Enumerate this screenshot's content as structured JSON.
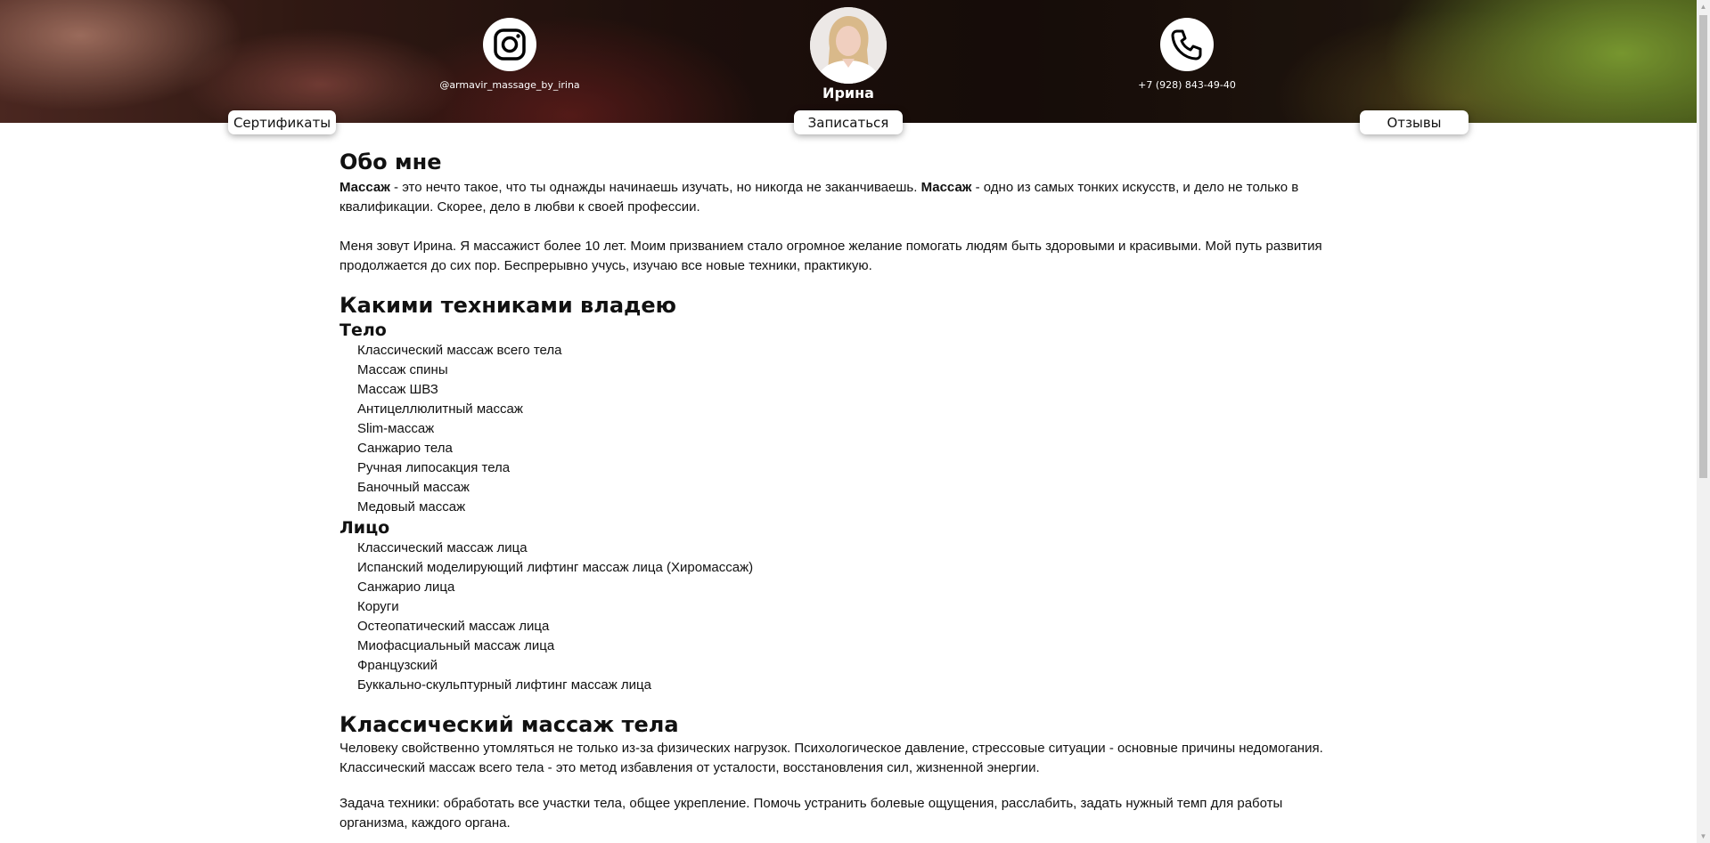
{
  "header": {
    "instagram_handle": "@armavir_massage_by_irina",
    "phone": "+7 (928) 843-49-40",
    "name": "Ирина",
    "buttons": {
      "certificates": "Сертификаты",
      "signup": "Записаться",
      "reviews": "Отзывы"
    }
  },
  "about": {
    "title": "Обо мне",
    "p1_bold1": "Массаж",
    "p1_mid": " - это нечто такое, что ты однажды начинаешь изучать, но никогда не заканчиваешь. ",
    "p1_bold2": "Массаж",
    "p1_end": " - одно из самых тонких искусств, и дело не только в квалификации. Скорее, дело в любви к своей профессии.",
    "p2": "Меня зовут Ирина. Я массажист более 10 лет. Моим призванием стало огромное желание помогать людям быть здоровыми и красивыми. Мой путь развития продолжается до сих пор. Беспрерывно учусь, изучаю все новые техники, практикую."
  },
  "techniques": {
    "title": "Какими техниками владею",
    "body_title": "Тело",
    "body": [
      "Классический массаж всего тела",
      "Массаж спины",
      "Массаж ШВЗ",
      "Антицеллюлитный массаж",
      "Slim-массаж",
      "Санжарио тела",
      "Ручная липосакция тела",
      "Баночный массаж",
      "Медовый массаж"
    ],
    "face_title": "Лицо",
    "face": [
      "Классический массаж лица",
      "Испанский моделирующий лифтинг массаж лица (Хиромассаж)",
      "Санжарио лица",
      "Коруги",
      "Остеопатический массаж лица",
      "Миофасциальный массаж лица",
      "Французский",
      "Буккально-скульптурный лифтинг массаж лица"
    ]
  },
  "classic": {
    "title": "Классический массаж тела",
    "p1": "Человеку свойственно утомляться не только из-за физических нагрузок. Психологическое давление, стрессовые ситуации - основные причины недомогания. Классический массаж всего тела - это метод избавления от усталости, восстановления сил, жизненной энергии.",
    "p2": "Задача техники: обработать все участки тела, общее укрепление. Помочь устранить болевые ощущения, расслабить, задать нужный темп для работы организма, каждого органа."
  },
  "icons": {
    "instagram": "instagram-icon",
    "phone": "phone-icon",
    "avatar": "avatar"
  }
}
